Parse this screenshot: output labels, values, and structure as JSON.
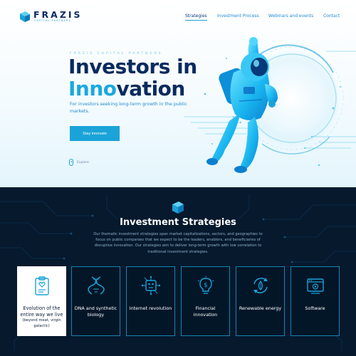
{
  "brand": {
    "name": "FRAZIS",
    "subtitle": "CAPITAL PARTNERS",
    "accent_color": "#1aa3d8",
    "navy_color": "#0a2a5e"
  },
  "nav": {
    "items": [
      {
        "label": "Strategies",
        "active": true
      },
      {
        "label": "Investment Process",
        "active": false
      },
      {
        "label": "Webinars and events",
        "active": false
      },
      {
        "label": "Contact",
        "active": false
      }
    ]
  },
  "hero": {
    "eyebrow": "FRAZIS CAPITAL PARTNERS",
    "headline_line1": "Investors in",
    "headline_accent": "Inno",
    "headline_rest": "vation",
    "tagline": "For investors seeking long-term growth in the public markets.",
    "cta_label": "Stay innovate",
    "explore_label": "Explore",
    "illustration": "astronaut"
  },
  "strategies": {
    "icon": "cube-logo-icon",
    "title": "Investment Strategies",
    "description": "Our thematic investment strategies span market capitalizations, sectors, and geographies to focus on public companies that we expect to be the leaders, enablers, and beneficiaries of disruptive innovation. Our strategies aim to deliver long-term growth with low correlation to traditional investment strategies.",
    "background_color": "#06192d",
    "cards": [
      {
        "label": "Evolution of the entire way we live",
        "sub": "(beyond meat, virgin galactic)",
        "icon": "clipboard-heart-icon",
        "featured": true
      },
      {
        "label": "DNA and synthetic biology",
        "icon": "dna-icon",
        "featured": false
      },
      {
        "label": "Internet revolution",
        "icon": "robot-chip-icon",
        "featured": false
      },
      {
        "label": "Financial innovation",
        "icon": "lightbulb-dollar-icon",
        "featured": false
      },
      {
        "label": "Renewable energy",
        "icon": "recycle-leaf-icon",
        "featured": false
      },
      {
        "label": "Software",
        "icon": "software-window-icon",
        "featured": false
      }
    ]
  }
}
